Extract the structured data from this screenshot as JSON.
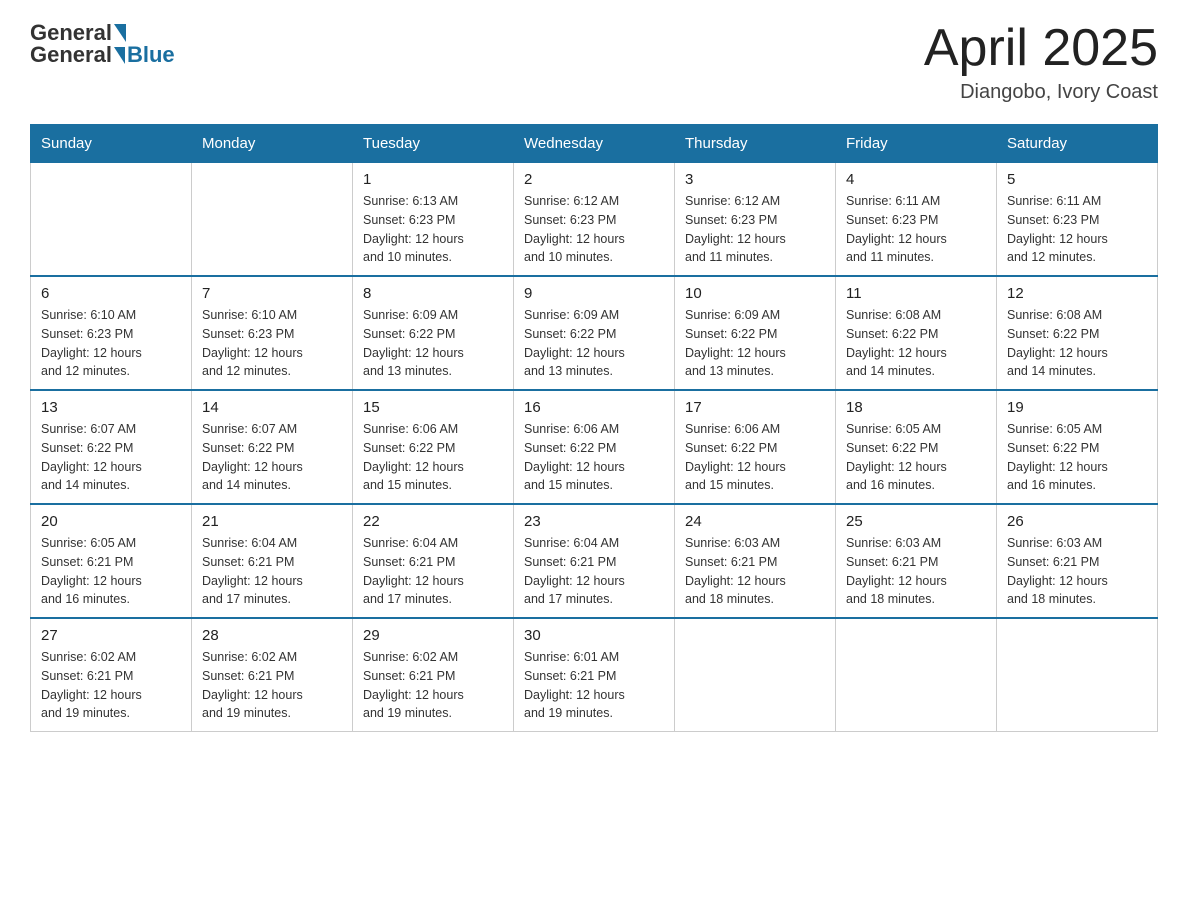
{
  "header": {
    "logo_general": "General",
    "logo_blue": "Blue",
    "month_title": "April 2025",
    "location": "Diangobo, Ivory Coast"
  },
  "days_of_week": [
    "Sunday",
    "Monday",
    "Tuesday",
    "Wednesday",
    "Thursday",
    "Friday",
    "Saturday"
  ],
  "weeks": [
    [
      {
        "day": "",
        "info": ""
      },
      {
        "day": "",
        "info": ""
      },
      {
        "day": "1",
        "info": "Sunrise: 6:13 AM\nSunset: 6:23 PM\nDaylight: 12 hours\nand 10 minutes."
      },
      {
        "day": "2",
        "info": "Sunrise: 6:12 AM\nSunset: 6:23 PM\nDaylight: 12 hours\nand 10 minutes."
      },
      {
        "day": "3",
        "info": "Sunrise: 6:12 AM\nSunset: 6:23 PM\nDaylight: 12 hours\nand 11 minutes."
      },
      {
        "day": "4",
        "info": "Sunrise: 6:11 AM\nSunset: 6:23 PM\nDaylight: 12 hours\nand 11 minutes."
      },
      {
        "day": "5",
        "info": "Sunrise: 6:11 AM\nSunset: 6:23 PM\nDaylight: 12 hours\nand 12 minutes."
      }
    ],
    [
      {
        "day": "6",
        "info": "Sunrise: 6:10 AM\nSunset: 6:23 PM\nDaylight: 12 hours\nand 12 minutes."
      },
      {
        "day": "7",
        "info": "Sunrise: 6:10 AM\nSunset: 6:23 PM\nDaylight: 12 hours\nand 12 minutes."
      },
      {
        "day": "8",
        "info": "Sunrise: 6:09 AM\nSunset: 6:22 PM\nDaylight: 12 hours\nand 13 minutes."
      },
      {
        "day": "9",
        "info": "Sunrise: 6:09 AM\nSunset: 6:22 PM\nDaylight: 12 hours\nand 13 minutes."
      },
      {
        "day": "10",
        "info": "Sunrise: 6:09 AM\nSunset: 6:22 PM\nDaylight: 12 hours\nand 13 minutes."
      },
      {
        "day": "11",
        "info": "Sunrise: 6:08 AM\nSunset: 6:22 PM\nDaylight: 12 hours\nand 14 minutes."
      },
      {
        "day": "12",
        "info": "Sunrise: 6:08 AM\nSunset: 6:22 PM\nDaylight: 12 hours\nand 14 minutes."
      }
    ],
    [
      {
        "day": "13",
        "info": "Sunrise: 6:07 AM\nSunset: 6:22 PM\nDaylight: 12 hours\nand 14 minutes."
      },
      {
        "day": "14",
        "info": "Sunrise: 6:07 AM\nSunset: 6:22 PM\nDaylight: 12 hours\nand 14 minutes."
      },
      {
        "day": "15",
        "info": "Sunrise: 6:06 AM\nSunset: 6:22 PM\nDaylight: 12 hours\nand 15 minutes."
      },
      {
        "day": "16",
        "info": "Sunrise: 6:06 AM\nSunset: 6:22 PM\nDaylight: 12 hours\nand 15 minutes."
      },
      {
        "day": "17",
        "info": "Sunrise: 6:06 AM\nSunset: 6:22 PM\nDaylight: 12 hours\nand 15 minutes."
      },
      {
        "day": "18",
        "info": "Sunrise: 6:05 AM\nSunset: 6:22 PM\nDaylight: 12 hours\nand 16 minutes."
      },
      {
        "day": "19",
        "info": "Sunrise: 6:05 AM\nSunset: 6:22 PM\nDaylight: 12 hours\nand 16 minutes."
      }
    ],
    [
      {
        "day": "20",
        "info": "Sunrise: 6:05 AM\nSunset: 6:21 PM\nDaylight: 12 hours\nand 16 minutes."
      },
      {
        "day": "21",
        "info": "Sunrise: 6:04 AM\nSunset: 6:21 PM\nDaylight: 12 hours\nand 17 minutes."
      },
      {
        "day": "22",
        "info": "Sunrise: 6:04 AM\nSunset: 6:21 PM\nDaylight: 12 hours\nand 17 minutes."
      },
      {
        "day": "23",
        "info": "Sunrise: 6:04 AM\nSunset: 6:21 PM\nDaylight: 12 hours\nand 17 minutes."
      },
      {
        "day": "24",
        "info": "Sunrise: 6:03 AM\nSunset: 6:21 PM\nDaylight: 12 hours\nand 18 minutes."
      },
      {
        "day": "25",
        "info": "Sunrise: 6:03 AM\nSunset: 6:21 PM\nDaylight: 12 hours\nand 18 minutes."
      },
      {
        "day": "26",
        "info": "Sunrise: 6:03 AM\nSunset: 6:21 PM\nDaylight: 12 hours\nand 18 minutes."
      }
    ],
    [
      {
        "day": "27",
        "info": "Sunrise: 6:02 AM\nSunset: 6:21 PM\nDaylight: 12 hours\nand 19 minutes."
      },
      {
        "day": "28",
        "info": "Sunrise: 6:02 AM\nSunset: 6:21 PM\nDaylight: 12 hours\nand 19 minutes."
      },
      {
        "day": "29",
        "info": "Sunrise: 6:02 AM\nSunset: 6:21 PM\nDaylight: 12 hours\nand 19 minutes."
      },
      {
        "day": "30",
        "info": "Sunrise: 6:01 AM\nSunset: 6:21 PM\nDaylight: 12 hours\nand 19 minutes."
      },
      {
        "day": "",
        "info": ""
      },
      {
        "day": "",
        "info": ""
      },
      {
        "day": "",
        "info": ""
      }
    ]
  ]
}
